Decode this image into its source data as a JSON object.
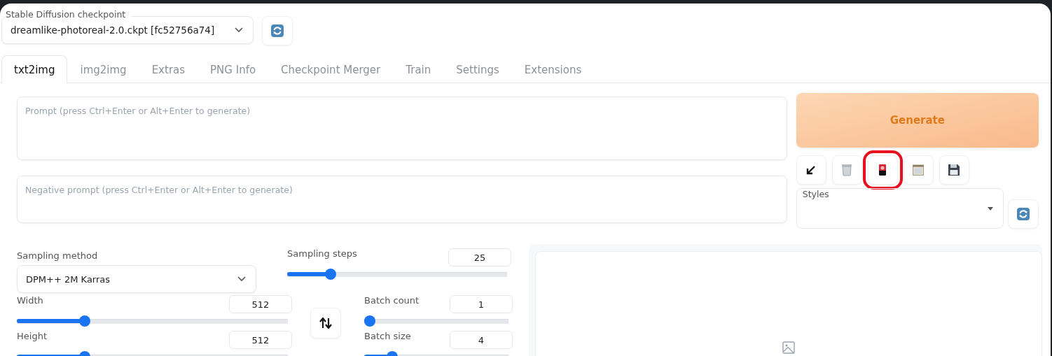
{
  "checkpoint": {
    "label": "Stable Diffusion checkpoint",
    "value": "dreamlike-photoreal-2.0.ckpt [fc52756a74]"
  },
  "tabs": [
    {
      "label": "txt2img",
      "selected": true
    },
    {
      "label": "img2img",
      "selected": false
    },
    {
      "label": "Extras",
      "selected": false
    },
    {
      "label": "PNG Info",
      "selected": false
    },
    {
      "label": "Checkpoint Merger",
      "selected": false
    },
    {
      "label": "Train",
      "selected": false
    },
    {
      "label": "Settings",
      "selected": false
    },
    {
      "label": "Extensions",
      "selected": false
    }
  ],
  "prompt": {
    "placeholder": "Prompt (press Ctrl+Enter or Alt+Enter to generate)"
  },
  "negative_prompt": {
    "placeholder": "Negative prompt (press Ctrl+Enter or Alt+Enter to generate)"
  },
  "generate_button": "Generate",
  "tools": [
    {
      "kind": "arrow",
      "highlighted": false
    },
    {
      "kind": "trash",
      "highlighted": false
    },
    {
      "kind": "card",
      "highlighted": true
    },
    {
      "kind": "notepad",
      "highlighted": false
    },
    {
      "kind": "save",
      "highlighted": false
    }
  ],
  "styles": {
    "label": "Styles"
  },
  "sampling_method": {
    "label": "Sampling method",
    "value": "DPM++ 2M Karras"
  },
  "sampling_steps": {
    "label": "Sampling steps",
    "value": "25",
    "level": 0.18
  },
  "width": {
    "label": "Width",
    "value": "512",
    "level": 0.24
  },
  "height": {
    "label": "Height",
    "value": "512",
    "level": 0.24
  },
  "batch_count": {
    "label": "Batch count",
    "value": "1",
    "level": 0
  },
  "batch_size": {
    "label": "Batch size",
    "value": "4",
    "level": 0.17
  }
}
